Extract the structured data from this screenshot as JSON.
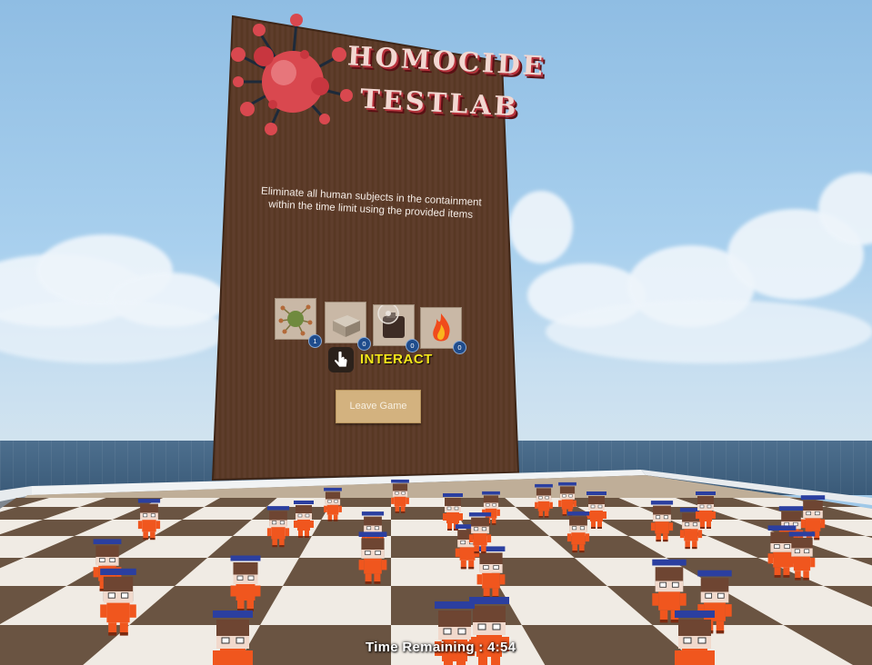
{
  "game": {
    "title_line_1": "HOMOCIDE",
    "title_line_2": "TESTLAB",
    "description": "Eliminate all human subjects in the containment within the time limit using the provided items",
    "items": [
      {
        "icon": "virus-item-icon",
        "count": "1"
      },
      {
        "icon": "crate-item-icon",
        "count": "0"
      },
      {
        "icon": "grenade-item-icon",
        "count": "0"
      },
      {
        "icon": "fire-item-icon",
        "count": "0"
      }
    ],
    "interact_label": "INTERACT",
    "leave_label": "Leave Game",
    "timer_text": "Time Remaining : 4:54"
  },
  "colors": {
    "board": "#5a3a28",
    "title_fill": "#f2d7d1",
    "title_shadow": "#b8323c",
    "interact": "#f4e61a",
    "leave_button": "#d3b27f",
    "jumpsuit": "#f0561e",
    "count_badge": "#1f4c8c"
  }
}
